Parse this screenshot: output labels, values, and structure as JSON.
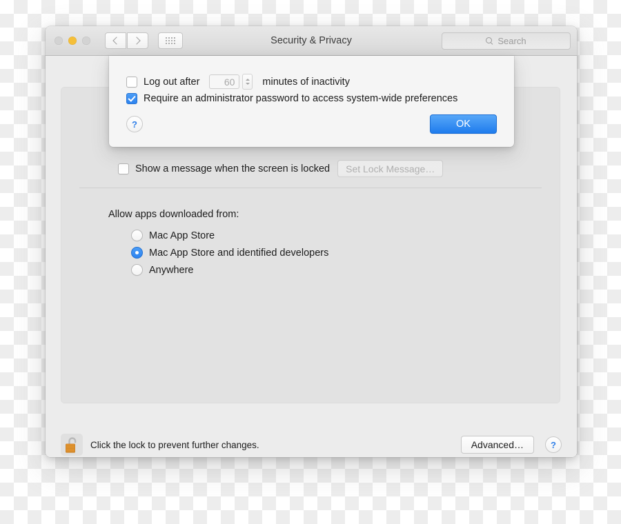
{
  "window": {
    "title": "Security & Privacy",
    "traffic_lights": [
      "close",
      "minimize",
      "zoom"
    ],
    "nav": {
      "back_icon": "chevron-left-icon",
      "forward_icon": "chevron-right-icon",
      "showall_icon": "grid-dots-icon"
    },
    "search": {
      "placeholder": "Search",
      "icon": "search-icon",
      "value": ""
    }
  },
  "sheet": {
    "logout": {
      "label": "Log out after",
      "checked": false,
      "minutes_value": "60",
      "suffix": "minutes of inactivity",
      "stepper_icon": "stepper-arrows-icon"
    },
    "require_admin": {
      "label": "Require an administrator password to access system-wide preferences",
      "checked": true
    },
    "help_label": "?",
    "ok_label": "OK"
  },
  "panel": {
    "show_message": {
      "label": "Show a message when the screen is locked",
      "checked": false,
      "button_label": "Set Lock Message…"
    },
    "allow_title": "Allow apps downloaded from:",
    "allow_options": [
      {
        "label": "Mac App Store",
        "selected": false
      },
      {
        "label": "Mac App Store and identified developers",
        "selected": true
      },
      {
        "label": "Anywhere",
        "selected": false
      }
    ]
  },
  "bottom": {
    "lock_icon": "padlock-open-icon",
    "lock_message": "Click the lock to prevent further changes.",
    "advanced_label": "Advanced…",
    "help_label": "?"
  },
  "colors": {
    "accent_blue": "#2d83ef",
    "window_bg": "#ececec",
    "panel_bg": "#e2e2e2",
    "sheet_bg": "#f5f5f5",
    "lock_gold": "#e8962f"
  }
}
